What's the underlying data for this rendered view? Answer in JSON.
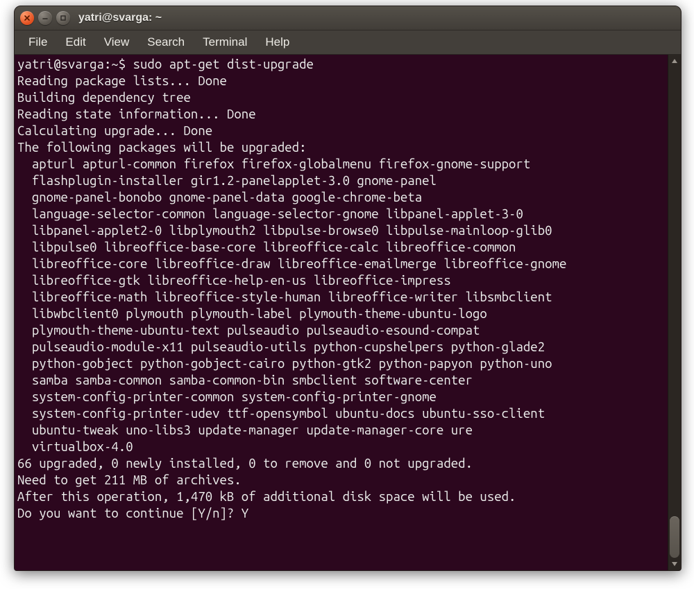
{
  "window": {
    "title": "yatri@svarga: ~"
  },
  "menubar": {
    "items": [
      "File",
      "Edit",
      "View",
      "Search",
      "Terminal",
      "Help"
    ]
  },
  "terminal": {
    "prompt": "yatri@svarga:~$ ",
    "command": "sudo apt-get dist-upgrade",
    "header_lines": [
      "Reading package lists... Done",
      "Building dependency tree       ",
      "Reading state information... Done",
      "Calculating upgrade... Done",
      "The following packages will be upgraded:"
    ],
    "packages": [
      "apturl",
      "apturl-common",
      "firefox",
      "firefox-globalmenu",
      "firefox-gnome-support",
      "flashplugin-installer",
      "gir1.2-panelapplet-3.0",
      "gnome-panel",
      "gnome-panel-bonobo",
      "gnome-panel-data",
      "google-chrome-beta",
      "language-selector-common",
      "language-selector-gnome",
      "libpanel-applet-3-0",
      "libpanel-applet2-0",
      "libplymouth2",
      "libpulse-browse0",
      "libpulse-mainloop-glib0",
      "libpulse0",
      "libreoffice-base-core",
      "libreoffice-calc",
      "libreoffice-common",
      "libreoffice-core",
      "libreoffice-draw",
      "libreoffice-emailmerge",
      "libreoffice-gnome",
      "libreoffice-gtk",
      "libreoffice-help-en-us",
      "libreoffice-impress",
      "libreoffice-math",
      "libreoffice-style-human",
      "libreoffice-writer",
      "libsmbclient",
      "libwbclient0",
      "plymouth",
      "plymouth-label",
      "plymouth-theme-ubuntu-logo",
      "plymouth-theme-ubuntu-text",
      "pulseaudio",
      "pulseaudio-esound-compat",
      "pulseaudio-module-x11",
      "pulseaudio-utils",
      "python-cupshelpers",
      "python-glade2",
      "python-gobject",
      "python-gobject-cairo",
      "python-gtk2",
      "python-papyon",
      "python-uno",
      "samba",
      "samba-common",
      "samba-common-bin",
      "smbclient",
      "software-center",
      "system-config-printer-common",
      "system-config-printer-gnome",
      "system-config-printer-udev",
      "ttf-opensymbol",
      "ubuntu-docs",
      "ubuntu-sso-client",
      "ubuntu-tweak",
      "uno-libs3",
      "update-manager",
      "update-manager-core",
      "ure",
      "virtualbox-4.0"
    ],
    "summary_lines": [
      "66 upgraded, 0 newly installed, 0 to remove and 0 not upgraded.",
      "Need to get 211 MB of archives.",
      "After this operation, 1,470 kB of additional disk space will be used."
    ],
    "prompt_question": "Do you want to continue [Y/n]? ",
    "prompt_answer": "Y",
    "wrap_width": 76,
    "indent": "  "
  }
}
